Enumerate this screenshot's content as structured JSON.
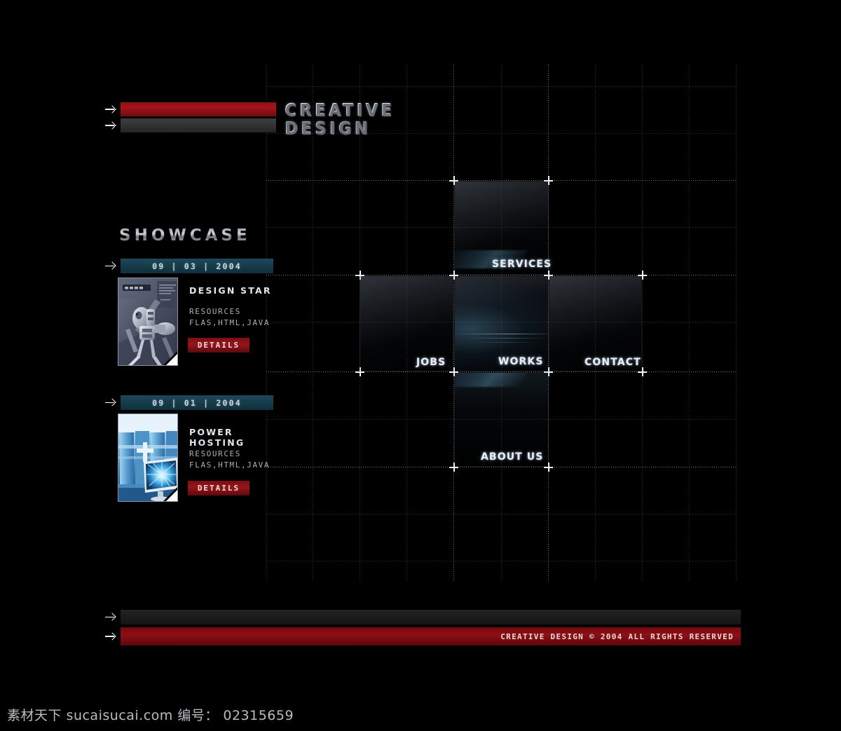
{
  "site": {
    "logo_line1": "CREATIVE",
    "logo_line2": "DESIGN"
  },
  "showcase": {
    "heading": "SHOWCASE",
    "items": [
      {
        "date": "09 | 03 | 2004",
        "title": "DESIGN STAR",
        "meta_label": "RESOURCES",
        "meta_value": "FLAS,HTML,JAVA",
        "button": "DETAILS",
        "thumb_name": "robot-mech-thumbnail"
      },
      {
        "date": "09 | 01 | 2004",
        "title": "POWER HOSTING",
        "meta_label": "RESOURCES",
        "meta_value": "FLAS,HTML,JAVA",
        "button": "DETAILS",
        "thumb_name": "server-monitor-thumbnail"
      }
    ]
  },
  "nav": {
    "items": [
      {
        "label": "SERVICES",
        "position": "top"
      },
      {
        "label": "JOBS",
        "position": "left"
      },
      {
        "label": "WORKS",
        "position": "center"
      },
      {
        "label": "CONTACT",
        "position": "right"
      },
      {
        "label": "ABOUT US",
        "position": "bottom"
      }
    ]
  },
  "footer": {
    "copyright": "CREATIVE DESIGN © 2004  ALL RIGHTS RESERVED"
  },
  "watermark": {
    "text": "素材天下 sucaisucai.com  编号： 02315659"
  },
  "colors": {
    "accent_red": "#8d1015",
    "accent_teal": "#173c4b",
    "background": "#000000",
    "text_light": "#e2e6ec"
  }
}
